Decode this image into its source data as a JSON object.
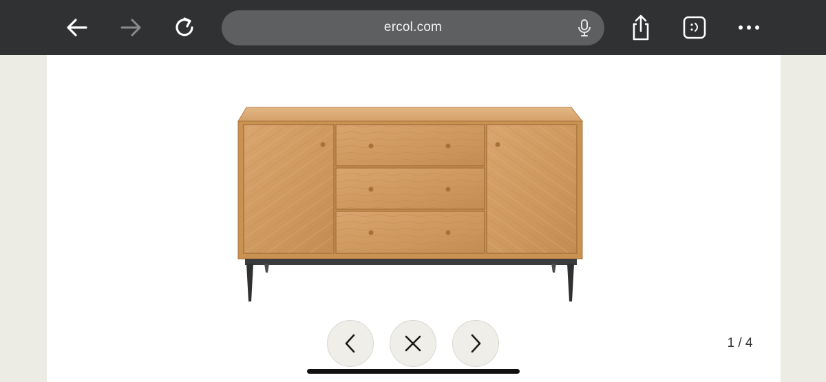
{
  "browser": {
    "url": "ercol.com",
    "icons": {
      "back": "arrow-left-icon",
      "forward": "arrow-right-icon",
      "reload": "reload-icon",
      "mic": "microphone-icon",
      "share": "share-icon",
      "extension": "smiley-box-icon",
      "more": "more-dots-icon"
    },
    "colors": {
      "toolbar": "#2f3133",
      "urlbar": "#5d5f61"
    }
  },
  "gallery": {
    "image_alt": "",
    "counter": "1 / 4",
    "controls": {
      "prev": "chevron-left-icon",
      "close": "close-icon",
      "next": "chevron-right-icon"
    },
    "colors": {
      "backdrop": "#ecebe4",
      "panel": "#ffffff"
    }
  }
}
